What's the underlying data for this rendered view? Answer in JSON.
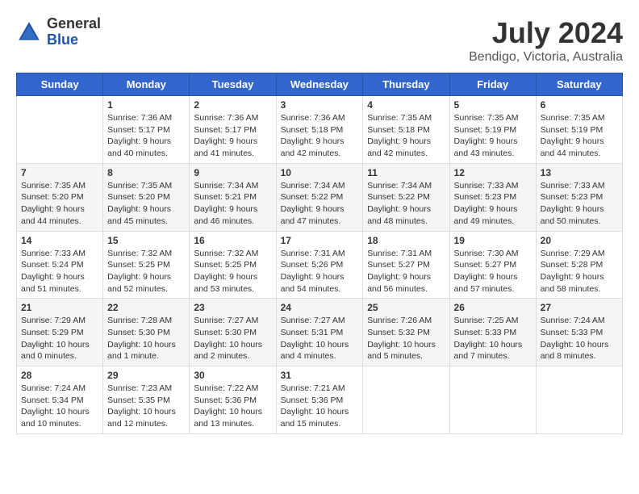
{
  "header": {
    "logo_general": "General",
    "logo_blue": "Blue",
    "month": "July 2024",
    "location": "Bendigo, Victoria, Australia"
  },
  "weekdays": [
    "Sunday",
    "Monday",
    "Tuesday",
    "Wednesday",
    "Thursday",
    "Friday",
    "Saturday"
  ],
  "weeks": [
    [
      {
        "day": "",
        "sunrise": "",
        "sunset": "",
        "daylight": ""
      },
      {
        "day": "1",
        "sunrise": "Sunrise: 7:36 AM",
        "sunset": "Sunset: 5:17 PM",
        "daylight": "Daylight: 9 hours and 40 minutes."
      },
      {
        "day": "2",
        "sunrise": "Sunrise: 7:36 AM",
        "sunset": "Sunset: 5:17 PM",
        "daylight": "Daylight: 9 hours and 41 minutes."
      },
      {
        "day": "3",
        "sunrise": "Sunrise: 7:36 AM",
        "sunset": "Sunset: 5:18 PM",
        "daylight": "Daylight: 9 hours and 42 minutes."
      },
      {
        "day": "4",
        "sunrise": "Sunrise: 7:35 AM",
        "sunset": "Sunset: 5:18 PM",
        "daylight": "Daylight: 9 hours and 42 minutes."
      },
      {
        "day": "5",
        "sunrise": "Sunrise: 7:35 AM",
        "sunset": "Sunset: 5:19 PM",
        "daylight": "Daylight: 9 hours and 43 minutes."
      },
      {
        "day": "6",
        "sunrise": "Sunrise: 7:35 AM",
        "sunset": "Sunset: 5:19 PM",
        "daylight": "Daylight: 9 hours and 44 minutes."
      }
    ],
    [
      {
        "day": "7",
        "sunrise": "Sunrise: 7:35 AM",
        "sunset": "Sunset: 5:20 PM",
        "daylight": "Daylight: 9 hours and 44 minutes."
      },
      {
        "day": "8",
        "sunrise": "Sunrise: 7:35 AM",
        "sunset": "Sunset: 5:20 PM",
        "daylight": "Daylight: 9 hours and 45 minutes."
      },
      {
        "day": "9",
        "sunrise": "Sunrise: 7:34 AM",
        "sunset": "Sunset: 5:21 PM",
        "daylight": "Daylight: 9 hours and 46 minutes."
      },
      {
        "day": "10",
        "sunrise": "Sunrise: 7:34 AM",
        "sunset": "Sunset: 5:22 PM",
        "daylight": "Daylight: 9 hours and 47 minutes."
      },
      {
        "day": "11",
        "sunrise": "Sunrise: 7:34 AM",
        "sunset": "Sunset: 5:22 PM",
        "daylight": "Daylight: 9 hours and 48 minutes."
      },
      {
        "day": "12",
        "sunrise": "Sunrise: 7:33 AM",
        "sunset": "Sunset: 5:23 PM",
        "daylight": "Daylight: 9 hours and 49 minutes."
      },
      {
        "day": "13",
        "sunrise": "Sunrise: 7:33 AM",
        "sunset": "Sunset: 5:23 PM",
        "daylight": "Daylight: 9 hours and 50 minutes."
      }
    ],
    [
      {
        "day": "14",
        "sunrise": "Sunrise: 7:33 AM",
        "sunset": "Sunset: 5:24 PM",
        "daylight": "Daylight: 9 hours and 51 minutes."
      },
      {
        "day": "15",
        "sunrise": "Sunrise: 7:32 AM",
        "sunset": "Sunset: 5:25 PM",
        "daylight": "Daylight: 9 hours and 52 minutes."
      },
      {
        "day": "16",
        "sunrise": "Sunrise: 7:32 AM",
        "sunset": "Sunset: 5:25 PM",
        "daylight": "Daylight: 9 hours and 53 minutes."
      },
      {
        "day": "17",
        "sunrise": "Sunrise: 7:31 AM",
        "sunset": "Sunset: 5:26 PM",
        "daylight": "Daylight: 9 hours and 54 minutes."
      },
      {
        "day": "18",
        "sunrise": "Sunrise: 7:31 AM",
        "sunset": "Sunset: 5:27 PM",
        "daylight": "Daylight: 9 hours and 56 minutes."
      },
      {
        "day": "19",
        "sunrise": "Sunrise: 7:30 AM",
        "sunset": "Sunset: 5:27 PM",
        "daylight": "Daylight: 9 hours and 57 minutes."
      },
      {
        "day": "20",
        "sunrise": "Sunrise: 7:29 AM",
        "sunset": "Sunset: 5:28 PM",
        "daylight": "Daylight: 9 hours and 58 minutes."
      }
    ],
    [
      {
        "day": "21",
        "sunrise": "Sunrise: 7:29 AM",
        "sunset": "Sunset: 5:29 PM",
        "daylight": "Daylight: 10 hours and 0 minutes."
      },
      {
        "day": "22",
        "sunrise": "Sunrise: 7:28 AM",
        "sunset": "Sunset: 5:30 PM",
        "daylight": "Daylight: 10 hours and 1 minute."
      },
      {
        "day": "23",
        "sunrise": "Sunrise: 7:27 AM",
        "sunset": "Sunset: 5:30 PM",
        "daylight": "Daylight: 10 hours and 2 minutes."
      },
      {
        "day": "24",
        "sunrise": "Sunrise: 7:27 AM",
        "sunset": "Sunset: 5:31 PM",
        "daylight": "Daylight: 10 hours and 4 minutes."
      },
      {
        "day": "25",
        "sunrise": "Sunrise: 7:26 AM",
        "sunset": "Sunset: 5:32 PM",
        "daylight": "Daylight: 10 hours and 5 minutes."
      },
      {
        "day": "26",
        "sunrise": "Sunrise: 7:25 AM",
        "sunset": "Sunset: 5:33 PM",
        "daylight": "Daylight: 10 hours and 7 minutes."
      },
      {
        "day": "27",
        "sunrise": "Sunrise: 7:24 AM",
        "sunset": "Sunset: 5:33 PM",
        "daylight": "Daylight: 10 hours and 8 minutes."
      }
    ],
    [
      {
        "day": "28",
        "sunrise": "Sunrise: 7:24 AM",
        "sunset": "Sunset: 5:34 PM",
        "daylight": "Daylight: 10 hours and 10 minutes."
      },
      {
        "day": "29",
        "sunrise": "Sunrise: 7:23 AM",
        "sunset": "Sunset: 5:35 PM",
        "daylight": "Daylight: 10 hours and 12 minutes."
      },
      {
        "day": "30",
        "sunrise": "Sunrise: 7:22 AM",
        "sunset": "Sunset: 5:36 PM",
        "daylight": "Daylight: 10 hours and 13 minutes."
      },
      {
        "day": "31",
        "sunrise": "Sunrise: 7:21 AM",
        "sunset": "Sunset: 5:36 PM",
        "daylight": "Daylight: 10 hours and 15 minutes."
      },
      {
        "day": "",
        "sunrise": "",
        "sunset": "",
        "daylight": ""
      },
      {
        "day": "",
        "sunrise": "",
        "sunset": "",
        "daylight": ""
      },
      {
        "day": "",
        "sunrise": "",
        "sunset": "",
        "daylight": ""
      }
    ]
  ]
}
